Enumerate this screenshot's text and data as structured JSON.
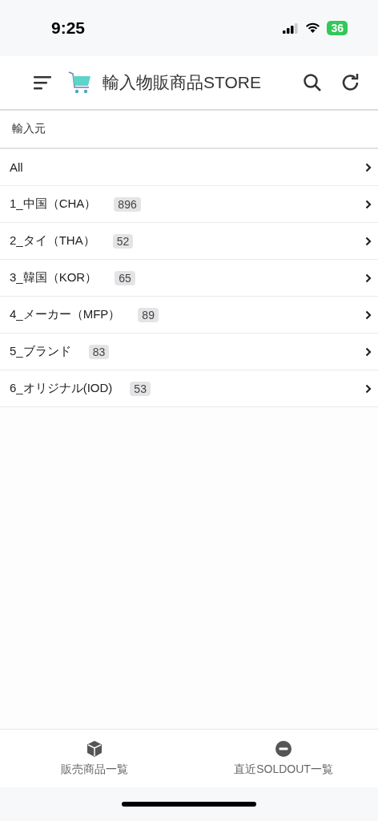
{
  "status_bar": {
    "time": "9:25",
    "battery": "36"
  },
  "header": {
    "title": "輸入物販商品STORE"
  },
  "section": {
    "label": "輸入元"
  },
  "items": [
    {
      "label": "All"
    },
    {
      "label": "1_中国（CHA）",
      "count": "896"
    },
    {
      "label": "2_タイ（THA）",
      "count": "52"
    },
    {
      "label": "3_韓国（KOR）",
      "count": "65"
    },
    {
      "label": "4_メーカー（MFP）",
      "count": "89"
    },
    {
      "label": "5_ブランド",
      "count": "83"
    },
    {
      "label": "6_オリジナル(IOD)",
      "count": "53"
    }
  ],
  "tabs": [
    {
      "label": "販売商品一覧",
      "kind": "products",
      "selected": false
    },
    {
      "label": "直近SOLDOUT一覧",
      "kind": "soldout",
      "selected": false
    }
  ]
}
